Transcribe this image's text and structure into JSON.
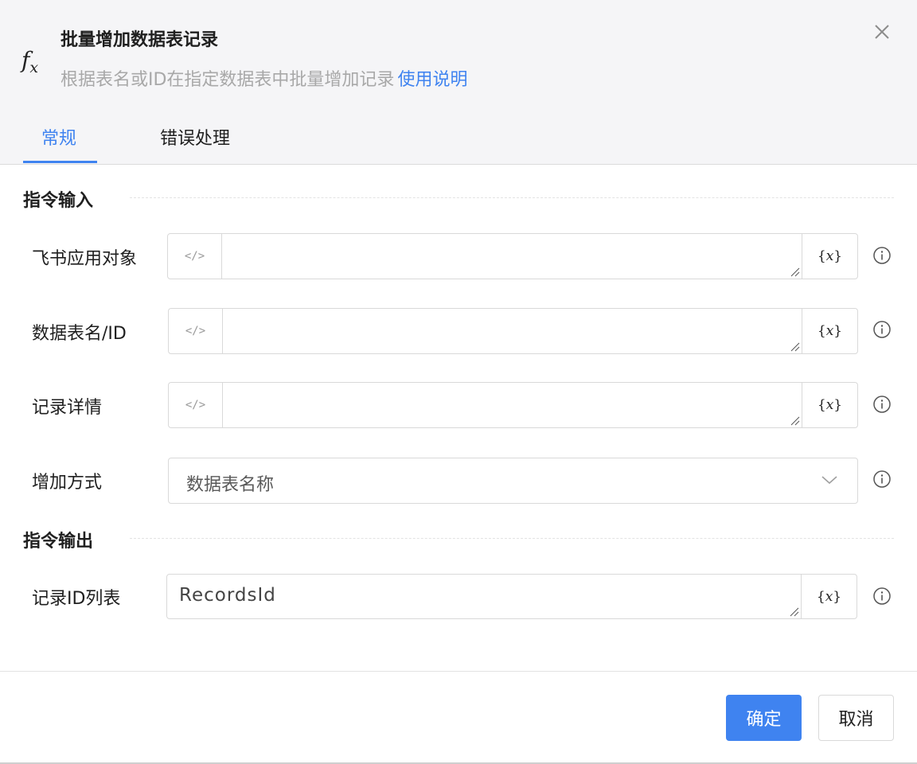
{
  "header": {
    "title": "批量增加数据表记录",
    "subtitle": "根据表名或ID在指定数据表中批量增加记录",
    "help_link": "使用说明",
    "icon": "fx-function-icon"
  },
  "tabs": [
    {
      "label": "常规",
      "active": true
    },
    {
      "label": "错误处理",
      "active": false
    }
  ],
  "sections": {
    "input_title": "指令输入",
    "output_title": "指令输出"
  },
  "fields": {
    "feishu_app": {
      "label": "飞书应用对象",
      "value": ""
    },
    "table_name": {
      "label": "数据表名/ID",
      "value": ""
    },
    "record_detail": {
      "label": "记录详情",
      "value": ""
    },
    "add_mode": {
      "label": "增加方式",
      "value": "数据表名称"
    },
    "record_ids": {
      "label": "记录ID列表",
      "value": "RecordsId"
    }
  },
  "widgets": {
    "code_toggle": "</>",
    "variable_prefix": "{",
    "variable_symbol": "x",
    "variable_suffix": "}"
  },
  "footer": {
    "confirm_label": "确定",
    "cancel_label": "取消"
  },
  "colors": {
    "accent": "#3f83f0",
    "header_bg": "#f5f5f7",
    "muted_text": "#a8a8a8"
  }
}
